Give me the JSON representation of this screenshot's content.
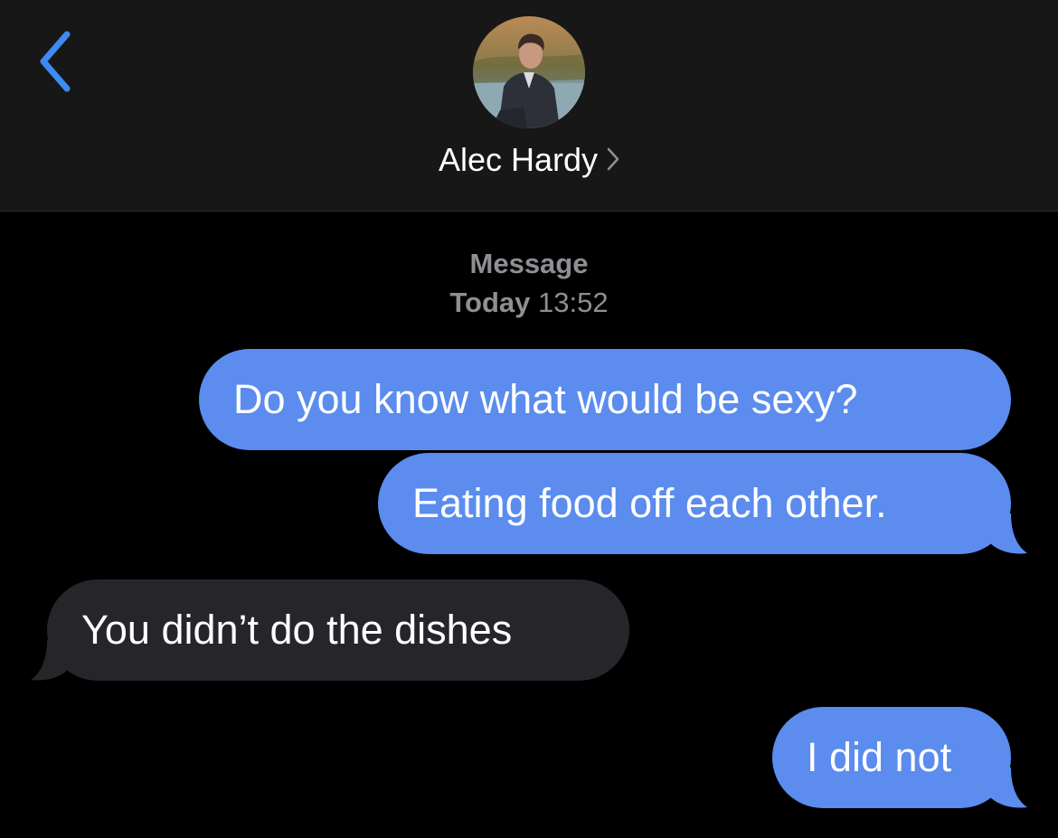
{
  "header": {
    "back_icon": "chevron-left-icon",
    "avatar_alt": "contact-photo",
    "contact_name": "Alec Hardy",
    "contact_chevron_icon": "chevron-right-icon"
  },
  "thread_meta": {
    "service_label": "Message",
    "day_label": "Today",
    "time": "13:52"
  },
  "messages": [
    {
      "direction": "sent",
      "text": "Do you know what would be sexy?",
      "tail": false
    },
    {
      "direction": "sent",
      "text": "Eating food off each other.",
      "tail": true
    },
    {
      "direction": "received",
      "text": "You didn’t do the dishes",
      "tail": true
    },
    {
      "direction": "sent",
      "text": "I did not",
      "tail": true
    }
  ],
  "colors": {
    "accent": "#3d8bf2",
    "sent_bubble": "#5b8cee",
    "received_bubble": "#26262a",
    "header_bg": "#171717",
    "background": "#000000",
    "meta_text": "#8e8e93"
  }
}
